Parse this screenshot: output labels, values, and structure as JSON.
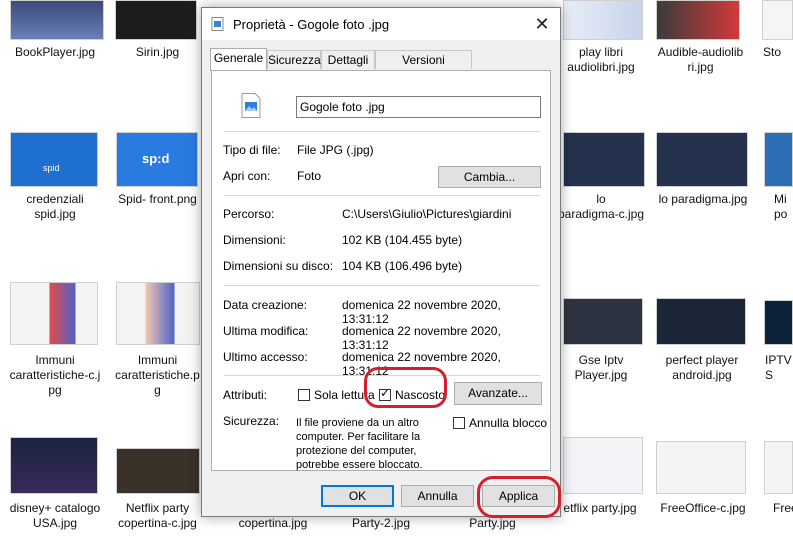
{
  "desktop": {
    "files": [
      {
        "label": "BookPlayer.jpg"
      },
      {
        "label": "Sirin.jpg"
      },
      {
        "label": "play libri\naudiolibri.jpg"
      },
      {
        "label": "Audible-audiolib\nri.jpg"
      },
      {
        "label": "Sto"
      },
      {
        "label": "credenziali\nspid.jpg"
      },
      {
        "label": "Spid- front.png"
      },
      {
        "label": "lo\nparadigma-c.jpg"
      },
      {
        "label": "lo paradigma.jpg"
      },
      {
        "label": "Mi\npo"
      },
      {
        "label": "Immuni\ncaratteristiche-c.j\npg"
      },
      {
        "label": "Immuni\ncaratteristiche.p\ng"
      },
      {
        "label": "Gse Iptv\nPlayer.jpg"
      },
      {
        "label": "perfect player\nandroid.jpg"
      },
      {
        "label": "IPTV S"
      },
      {
        "label": "disney+ catalogo\nUSA.jpg"
      },
      {
        "label": "Netflix party\ncopertina-c.jpg"
      },
      {
        "label": "copertina.jpg"
      },
      {
        "label": "Party-2.jpg"
      },
      {
        "label": "Party.jpg"
      },
      {
        "label": "etflix party.jpg"
      },
      {
        "label": "FreeOffice-c.jpg"
      },
      {
        "label": "Free"
      }
    ],
    "thumb_labels": {
      "spid_text": "spid",
      "spid_front_text": "sp:d"
    }
  },
  "dialog": {
    "title": "Proprietà - Gogole foto .jpg",
    "close": "✕",
    "tabs": [
      "Generale",
      "Sicurezza",
      "Dettagli",
      "Versioni precedenti"
    ],
    "filename": "Gogole foto .jpg",
    "type_label": "Tipo di file:",
    "type_value": "File JPG (.jpg)",
    "open_label": "Apri con:",
    "open_value": "Foto",
    "change_button": "Cambia...",
    "path_label": "Percorso:",
    "path_value": "C:\\Users\\Giulio\\Pictures\\giardini",
    "size_label": "Dimensioni:",
    "size_value": "102 KB (104.455 byte)",
    "disk_label": "Dimensioni su disco:",
    "disk_value": "104 KB (106.496 byte)",
    "created_label": "Data creazione:",
    "created_value": "domenica 22 novembre 2020, 13:31:12",
    "modified_label": "Ultima modifica:",
    "modified_value": "domenica 22 novembre 2020, 13:31:12",
    "accessed_label": "Ultimo accesso:",
    "accessed_value": "domenica 22 novembre 2020, 13:31:12",
    "attr_label": "Attributi:",
    "readonly_label": "Sola lettura",
    "readonly_checked": false,
    "hidden_label": "Nascosto",
    "hidden_checked": true,
    "advanced_button": "Avanzate...",
    "security_label": "Sicurezza:",
    "security_text": "Il file proviene da un altro\ncomputer. Per facilitare la\nprotezione del computer,\npotrebbe essere bloccato.",
    "unblock_label": "Annulla blocco",
    "unblock_checked": false,
    "ok_button": "OK",
    "cancel_button": "Annulla",
    "apply_button": "Applica",
    "highlight_color": "#d4202a",
    "accent_color": "#0078d7"
  }
}
